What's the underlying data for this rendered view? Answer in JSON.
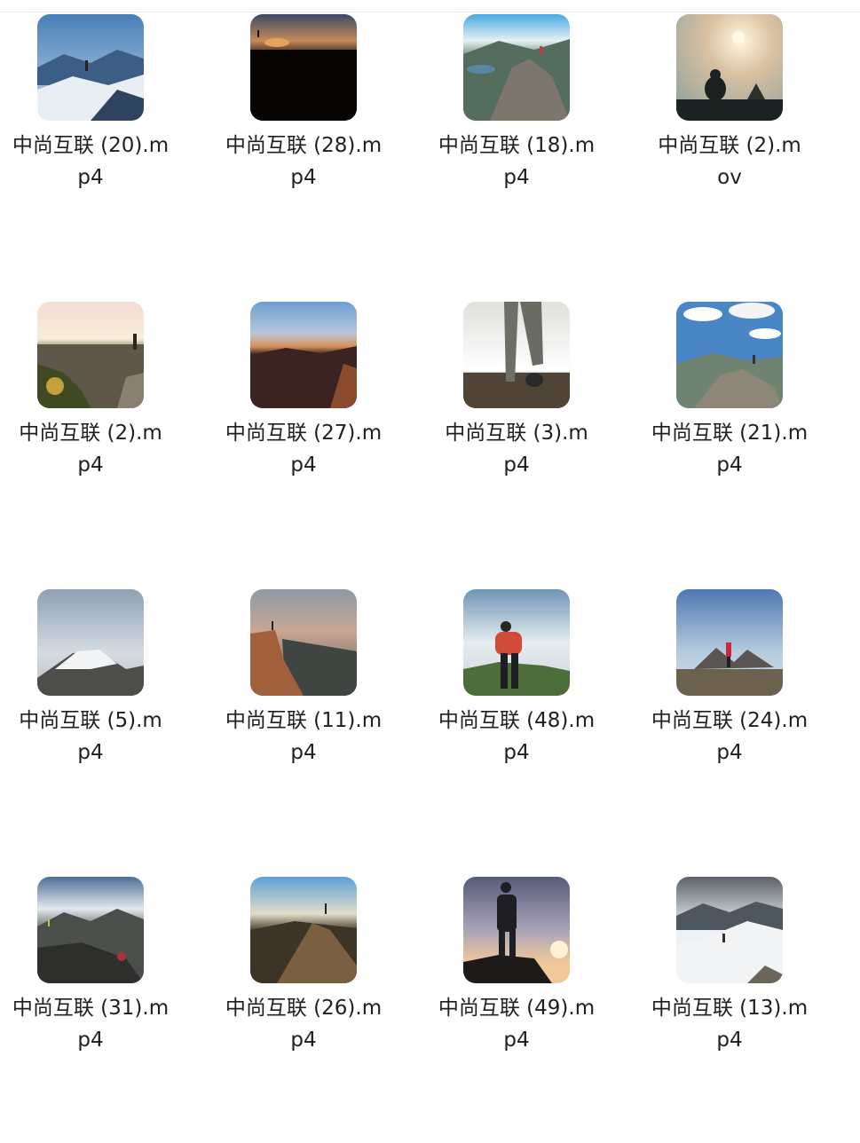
{
  "files": [
    {
      "name": "中尚互联 (20).m\np4",
      "thumb": "mountain-snow-blue"
    },
    {
      "name": "中尚互联 (28).m\np4",
      "thumb": "arch-sunset-dark"
    },
    {
      "name": "中尚互联 (18).m\np4",
      "thumb": "rocky-summit-lake"
    },
    {
      "name": "中尚互联 (2).m\nov",
      "thumb": "hazy-sun-silhouette"
    },
    {
      "name": "中尚互联 (2).m\np4",
      "thumb": "sunrise-ridge-shrubs"
    },
    {
      "name": "中尚互联 (27).m\np4",
      "thumb": "dusk-valley"
    },
    {
      "name": "中尚互联 (3).m\np4",
      "thumb": "legs-walking"
    },
    {
      "name": "中尚互联 (21).m\np4",
      "thumb": "cloudy-rock-summit"
    },
    {
      "name": "中尚互联 (5).m\np4",
      "thumb": "misty-snow-peak"
    },
    {
      "name": "中尚互联 (11).m\np4",
      "thumb": "cliff-dusk"
    },
    {
      "name": "中尚互联 (48).m\np4",
      "thumb": "hiker-red-jacket-grass"
    },
    {
      "name": "中尚互联 (24).m\np4",
      "thumb": "hiker-peak-horizon"
    },
    {
      "name": "中尚互联 (31).m\np4",
      "thumb": "rocky-hillside-clouds"
    },
    {
      "name": "中尚互联 (26).m\np4",
      "thumb": "rocky-ridge-evening"
    },
    {
      "name": "中尚互联 (49).m\np4",
      "thumb": "hiker-sunset-rock"
    },
    {
      "name": "中尚互联 (13).m\np4",
      "thumb": "snow-ridge-hiker"
    }
  ]
}
